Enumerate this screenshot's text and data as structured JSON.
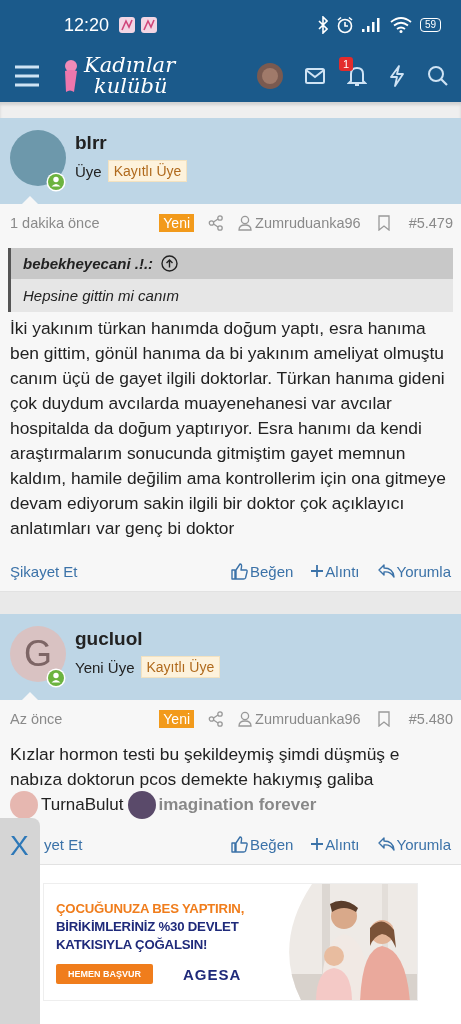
{
  "status_bar": {
    "time": "12:20",
    "battery": "59"
  },
  "app_bar": {
    "logo": [
      "Kadınlar",
      "kulübü"
    ],
    "notification_count": "1"
  },
  "posts": [
    {
      "username": "blrr",
      "avatar": {
        "kind": "blank"
      },
      "role": "Üye",
      "badge": "Kayıtlı Üye",
      "online": true,
      "time": "1 dakika önce",
      "new_label": "Yeni",
      "author": "Zumruduanka96",
      "number": "#5.479",
      "quote": {
        "author": "bebekheyecani .!.:",
        "text": "Hepsine gittin mi canım"
      },
      "body": "İki yakınım türkan hanımda doğum yaptı, esra hanıma ben gittim, gönül hanıma da bi yakınım ameliyat olmuştu canım üçü de gayet ilgili doktorlar. Türkan hanıma gideni çok duydum avcılarda muayenehanesi var avcılar hospitalda da doğum yaptırıyor. Esra hanımı da kendi araştırmalarım sonucunda gitmiştim gayet memnun kaldım, hamile değilim ama kontrollerim için ona gitmeye devam ediyorum sakin ilgili bir doktor çok açıklayıcı anlatımları var genç bi doktor",
      "actions": {
        "report": "Şikayet Et",
        "like": "Beğen",
        "quote": "Alıntı",
        "reply": "Yorumla"
      }
    },
    {
      "username": "gucluol",
      "avatar": {
        "kind": "letter",
        "letter": "G"
      },
      "role": "Yeni Üye",
      "badge": "Kayıtlı Üye",
      "online": true,
      "time": "Az önce",
      "new_label": "Yeni",
      "author": "Zumruduanka96",
      "number": "#5.480",
      "body": "Kızlar hormon testi bu şekildeymiş şimdi düşmüş e nabıza doktorun pcos demekte hakıymış galiba",
      "likes": [
        {
          "name": "TurnaBulut",
          "faded": false
        },
        {
          "name": "imagination forever",
          "faded": true
        }
      ],
      "actions": {
        "report": "yet Et",
        "like": "Beğen",
        "quote": "Alıntı",
        "reply": "Yorumla"
      }
    }
  ],
  "side_tab": {
    "label": "X"
  },
  "ad": {
    "headline": [
      {
        "text": "ÇOCUĞUNUZA BES YAPTIRIN,",
        "color": "#f07d1c"
      },
      {
        "text": "BİRİKİMLERİNİZ %30 DEVLET",
        "color": "#1f2a7a"
      },
      {
        "text": "KATKISIYLA ÇOĞALSIN!",
        "color": "#1f2a7a"
      }
    ],
    "button": "HEMEN BAŞVUR",
    "brand": "AGESA"
  }
}
